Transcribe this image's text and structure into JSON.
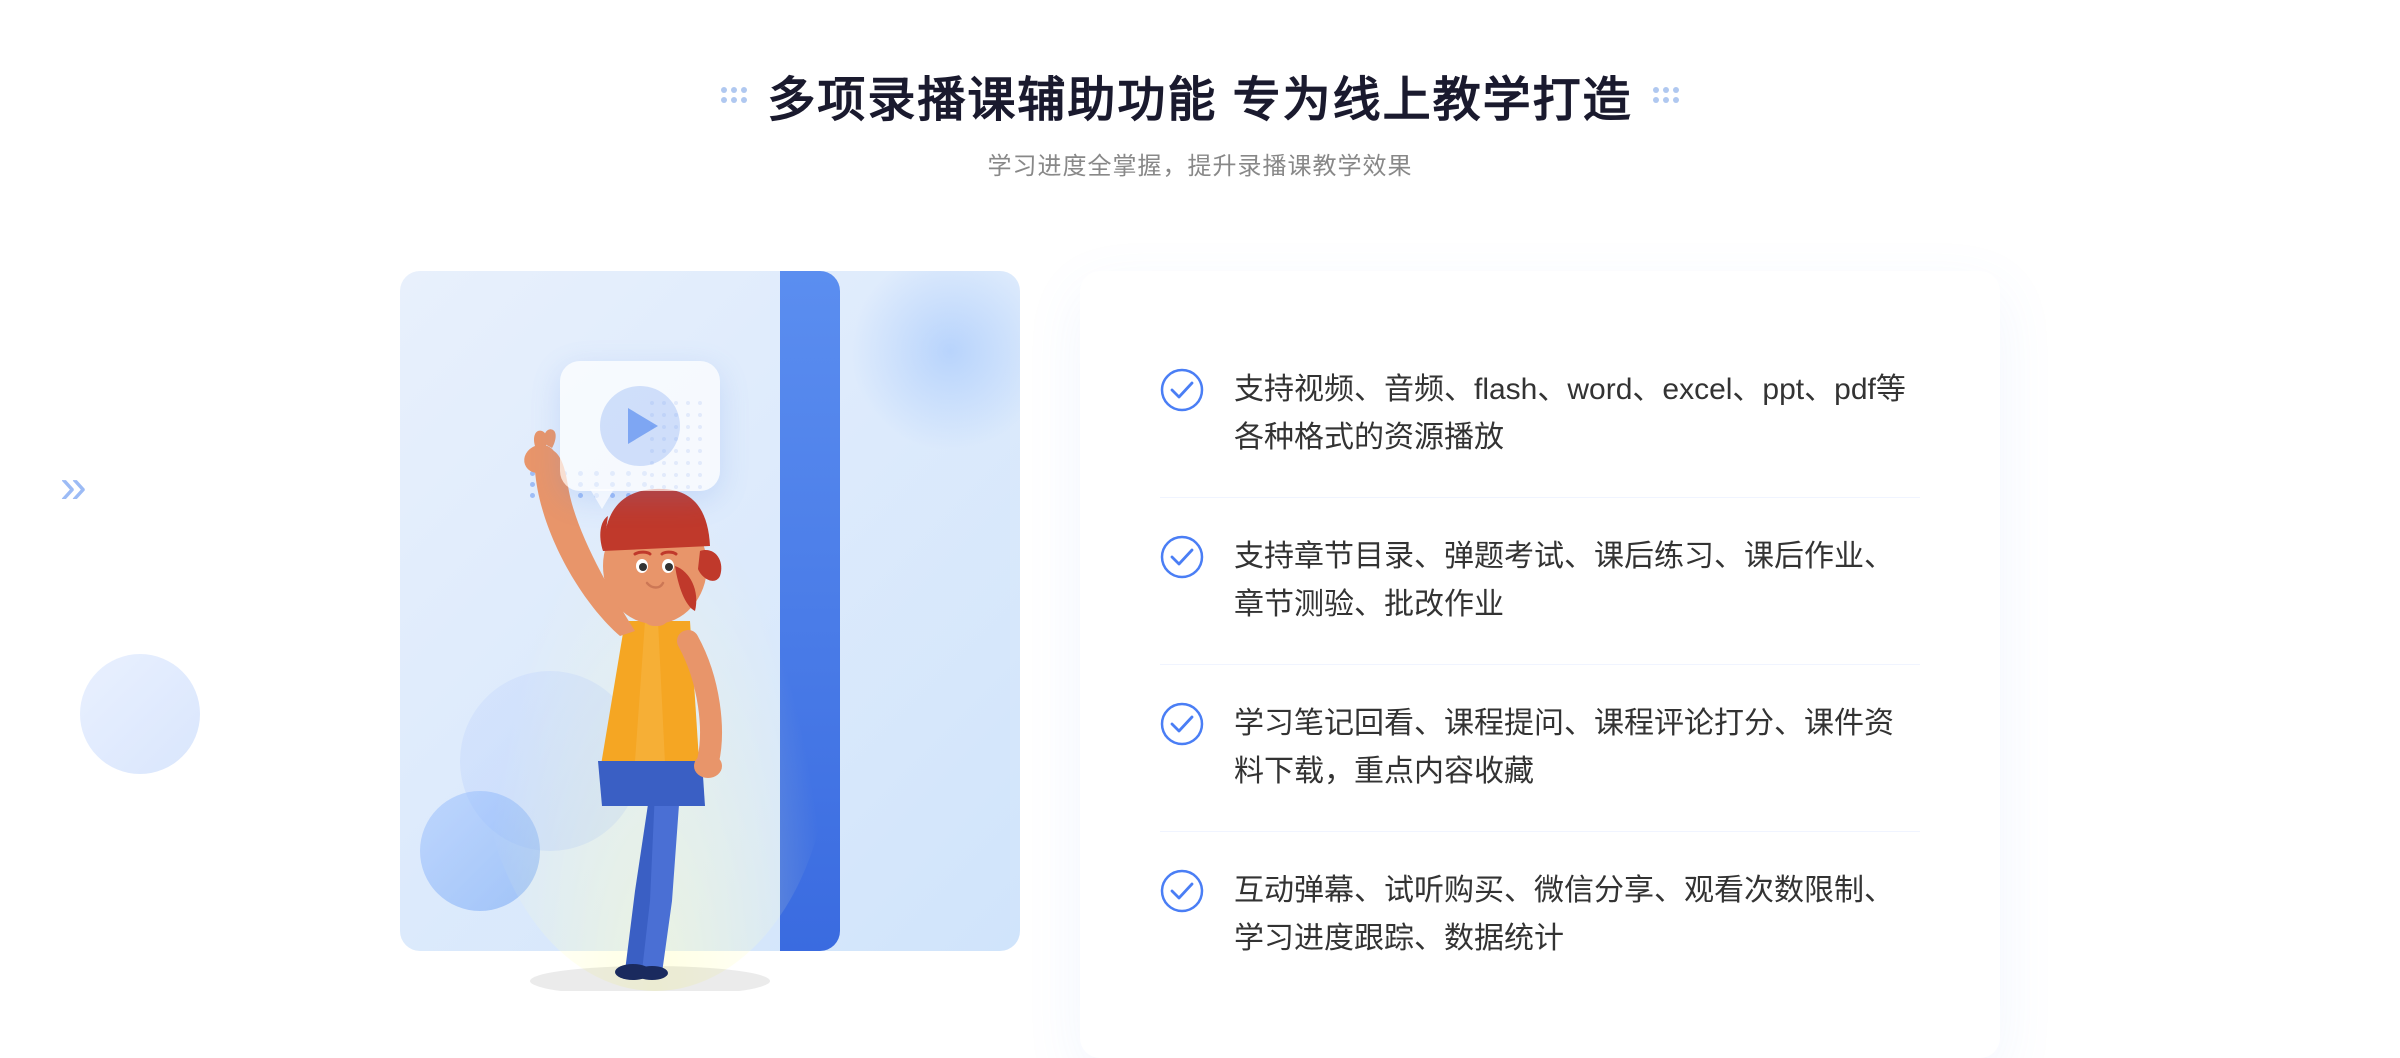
{
  "page": {
    "background": "#ffffff"
  },
  "header": {
    "title": "多项录播课辅助功能 专为线上教学打造",
    "subtitle": "学习进度全掌握，提升录播课教学效果",
    "left_dots_label": "header-left-decoration",
    "right_dots_label": "header-right-decoration"
  },
  "features": [
    {
      "id": 1,
      "text": "支持视频、音频、flash、word、excel、ppt、pdf等各种格式的资源播放"
    },
    {
      "id": 2,
      "text": "支持章节目录、弹题考试、课后练习、课后作业、章节测验、批改作业"
    },
    {
      "id": 3,
      "text": "学习笔记回看、课程提问、课程评论打分、课件资料下载，重点内容收藏"
    },
    {
      "id": 4,
      "text": "互动弹幕、试听购买、微信分享、观看次数限制、学习进度跟踪、数据统计"
    }
  ],
  "decoration": {
    "chevron_char": "»",
    "play_button_label": "play-button",
    "check_icon_label": "check-circle-icon"
  },
  "colors": {
    "primary_blue": "#4a7ef5",
    "light_blue": "#e8f0fc",
    "text_dark": "#333333",
    "text_gray": "#888888",
    "accent_blue": "#5b8ef0"
  }
}
